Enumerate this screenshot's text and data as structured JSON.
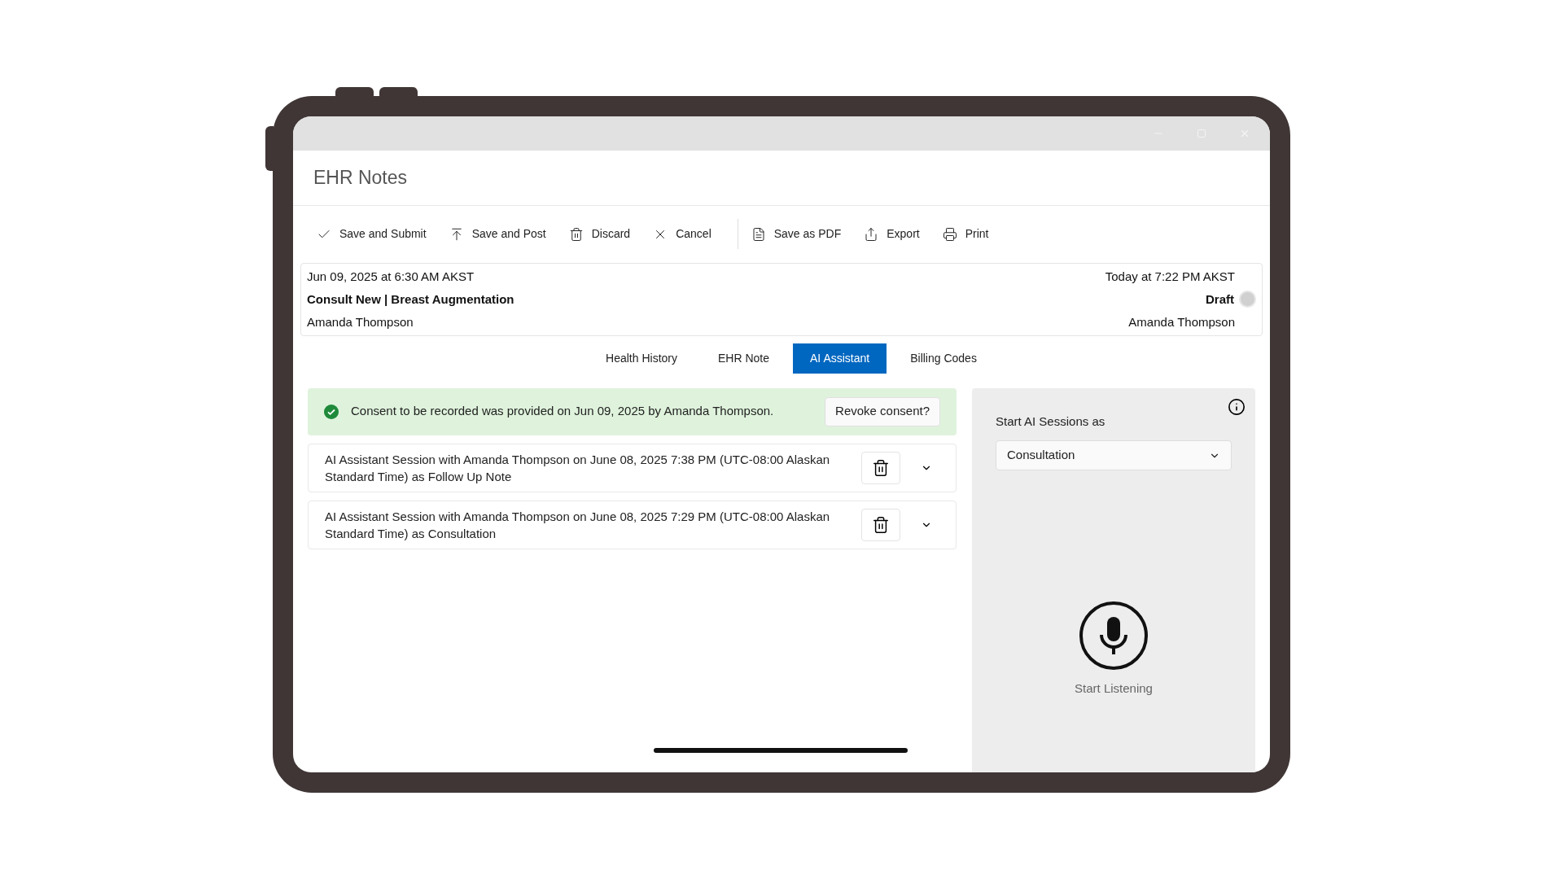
{
  "window": {
    "title": "EHR Notes"
  },
  "toolbar_groups": [
    [
      {
        "label": "Save and Submit"
      },
      {
        "label": "Save and Post"
      },
      {
        "label": "Discard"
      },
      {
        "label": "Cancel"
      }
    ],
    [
      {
        "label": "Save as PDF"
      },
      {
        "label": "Export"
      },
      {
        "label": "Print"
      }
    ]
  ],
  "note_header": {
    "created": "Jun 09, 2025 at 6:30 AM AKST",
    "title": "Consult New | Breast Augmentation",
    "author": "Amanda Thompson",
    "updated": "Today at 7:22 PM AKST",
    "status": "Draft",
    "editor": "Amanda Thompson"
  },
  "tabs": [
    {
      "label": "Health History",
      "selected": false
    },
    {
      "label": "EHR Note",
      "selected": false
    },
    {
      "label": "AI Assistant",
      "selected": true
    },
    {
      "label": "Billing Codes",
      "selected": false
    }
  ],
  "consent": {
    "message": "Consent to be recorded was provided on Jun 09, 2025 by Amanda Thompson.",
    "button": "Revoke consent?"
  },
  "sessions": [
    {
      "text": "AI Assistant Session with Amanda Thompson on June 08, 2025 7:38 PM (UTC-08:00 Alaskan Standard Time) as Follow Up Note",
      "expanded": false
    },
    {
      "text": "AI Assistant Session with Amanda Thompson on June 08, 2025 7:29 PM (UTC-08:00 Alaskan Standard Time) as Consultation",
      "expanded": false
    }
  ],
  "side_panel": {
    "label": "Start AI Sessions as",
    "session_type": "Consultation",
    "listen_label": "Start Listening"
  }
}
